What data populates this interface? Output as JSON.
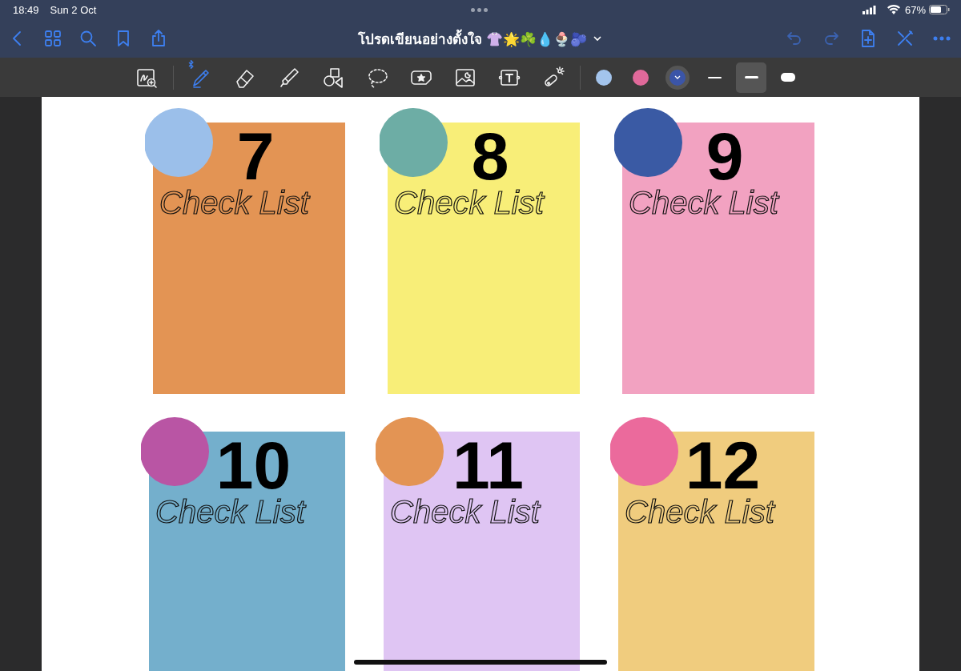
{
  "status_bar": {
    "time": "18:49",
    "date": "Sun 2 Oct",
    "battery": "67%"
  },
  "nav": {
    "title": "โปรดเขียนอย่างตั้งใจ 👚🌟☘️💧🍨🫐"
  },
  "tools": [
    {
      "kind": "zoom",
      "selected": false
    },
    {
      "kind": "pen",
      "selected": true
    },
    {
      "kind": "eraser",
      "selected": false
    },
    {
      "kind": "highlighter",
      "selected": false
    },
    {
      "kind": "shapes",
      "selected": false
    },
    {
      "kind": "lasso",
      "selected": false
    },
    {
      "kind": "sticker",
      "selected": false
    },
    {
      "kind": "image",
      "selected": false
    },
    {
      "kind": "text",
      "selected": false
    },
    {
      "kind": "laser",
      "selected": false
    }
  ],
  "colors": [
    {
      "color": "#a3c4ec",
      "selected": false
    },
    {
      "color": "#e0699a",
      "selected": false
    },
    {
      "color": "#3b55a8",
      "selected": true
    }
  ],
  "widths": [
    {
      "kind": "thin",
      "selected": false
    },
    {
      "kind": "medium",
      "selected": true
    },
    {
      "kind": "thick",
      "selected": false
    }
  ],
  "cards": [
    {
      "number": "7",
      "label": "Check List",
      "color": "#e39454",
      "circle": {
        "color": "#9bbfea"
      }
    },
    {
      "number": "8",
      "label": "Check List",
      "color": "#f8ee78",
      "circle": {
        "color": "#6dada5"
      }
    },
    {
      "number": "9",
      "label": "Check List",
      "color": "#f2a2c1",
      "circle": {
        "color": "#3a5aa4"
      }
    },
    {
      "number": "10",
      "label": "Check List",
      "color": "#74afcc",
      "circle": {
        "color": "#b955a4"
      }
    },
    {
      "number": "11",
      "label": "Check List",
      "color": "#dfc5f3",
      "circle": {
        "color": "#e39454"
      }
    },
    {
      "number": "12",
      "label": "Check List",
      "color": "#f0cc7e",
      "circle": {
        "color": "#eb6a9c"
      }
    }
  ]
}
